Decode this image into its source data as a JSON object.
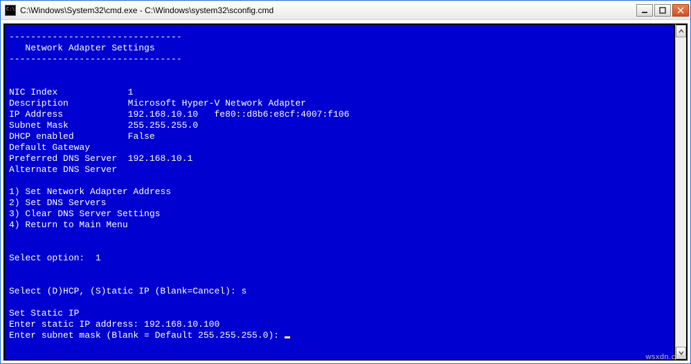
{
  "window": {
    "title": "C:\\Windows\\System32\\cmd.exe - C:\\Windows\\system32\\sconfig.cmd"
  },
  "header": {
    "rule": "--------------------------------",
    "title": "   Network Adapter Settings"
  },
  "fields": {
    "nic_index_label": "NIC Index",
    "nic_index_value": "1",
    "description_label": "Description",
    "description_value": "Microsoft Hyper-V Network Adapter",
    "ip_address_label": "IP Address",
    "ip_address_value": "192.168.10.10   fe80::d8b6:e8cf:4007:f106",
    "subnet_mask_label": "Subnet Mask",
    "subnet_mask_value": "255.255.255.0",
    "dhcp_enabled_label": "DHCP enabled",
    "dhcp_enabled_value": "False",
    "default_gateway_label": "Default Gateway",
    "default_gateway_value": "",
    "pref_dns_label": "Preferred DNS Server",
    "pref_dns_value": "192.168.10.1",
    "alt_dns_label": "Alternate DNS Server",
    "alt_dns_value": ""
  },
  "menu": {
    "opt1": "1) Set Network Adapter Address",
    "opt2": "2) Set DNS Servers",
    "opt3": "3) Clear DNS Server Settings",
    "opt4": "4) Return to Main Menu"
  },
  "prompts": {
    "select_option_label": "Select option:",
    "select_option_value": "1",
    "dhcp_static_prompt": "Select (D)HCP, (S)tatic IP (Blank=Cancel):",
    "dhcp_static_value": "s",
    "set_static_header": "Set Static IP",
    "enter_static_ip_label": "Enter static IP address:",
    "enter_static_ip_value": "192.168.10.100",
    "enter_subnet_label": "Enter subnet mask (Blank = Default 255.255.255.0):",
    "enter_subnet_value": ""
  },
  "watermark": "wsxdn.com"
}
